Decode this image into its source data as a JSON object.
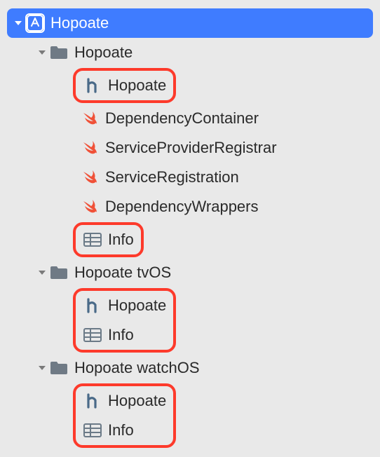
{
  "root": {
    "name": "Hopoate",
    "selected": true,
    "expanded": true
  },
  "groups": [
    {
      "name": "Hopoate",
      "expanded": true,
      "items": [
        {
          "name": "Hopoate",
          "icon": "header",
          "highlighted": true
        },
        {
          "name": "DependencyContainer",
          "icon": "swift",
          "highlighted": false
        },
        {
          "name": "ServiceProviderRegistrar",
          "icon": "swift",
          "highlighted": false
        },
        {
          "name": "ServiceRegistration",
          "icon": "swift",
          "highlighted": false
        },
        {
          "name": "DependencyWrappers",
          "icon": "swift",
          "highlighted": false
        },
        {
          "name": "Info",
          "icon": "plist",
          "highlighted": true
        }
      ]
    },
    {
      "name": "Hopoate tvOS",
      "expanded": true,
      "items_highlighted_together": true,
      "items": [
        {
          "name": "Hopoate",
          "icon": "header"
        },
        {
          "name": "Info",
          "icon": "plist"
        }
      ]
    },
    {
      "name": "Hopoate watchOS",
      "expanded": true,
      "items_highlighted_together": true,
      "items": [
        {
          "name": "Hopoate",
          "icon": "header"
        },
        {
          "name": "Info",
          "icon": "plist"
        }
      ]
    }
  ]
}
